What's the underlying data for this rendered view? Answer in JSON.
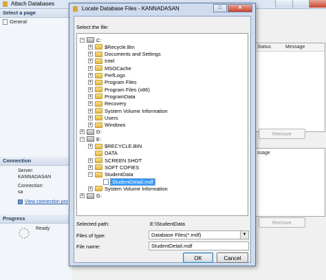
{
  "background_window": {
    "title": "Attach Databases",
    "sidebar": {
      "select_page_heading": "Select a page",
      "pages": [
        "General"
      ],
      "connection_heading": "Connection",
      "server_label": "Server:",
      "server_value": "KANNADASAN",
      "connection_label": "Connection:",
      "connection_value": "sa",
      "view_connection_link": "View connection pro",
      "progress_heading": "Progress",
      "progress_status": "Ready"
    },
    "grid_headers": {
      "status": "Status",
      "message": "Message"
    },
    "lower_grid_header": "ssage",
    "remove_button_top": "Remove",
    "remove_button_bottom": "Remove"
  },
  "dialog": {
    "title": "Locate Database Files - KANNADASAN",
    "select_file_label": "Select the file:",
    "tree": [
      {
        "label": "C:",
        "kind": "drive",
        "expander": "−"
      },
      {
        "label": "$Recycle.Bin",
        "kind": "folder",
        "expander": "+"
      },
      {
        "label": "Documents and Settings",
        "kind": "folder",
        "expander": "+"
      },
      {
        "label": "Intel",
        "kind": "folder",
        "expander": "+"
      },
      {
        "label": "MSOCache",
        "kind": "folder",
        "expander": "+"
      },
      {
        "label": "PerfLogs",
        "kind": "folder",
        "expander": "+"
      },
      {
        "label": "Program Files",
        "kind": "folder",
        "expander": "+"
      },
      {
        "label": "Program Files (x86)",
        "kind": "folder",
        "expander": "+"
      },
      {
        "label": "ProgramData",
        "kind": "folder",
        "expander": "+"
      },
      {
        "label": "Recovery",
        "kind": "folder",
        "expander": "+"
      },
      {
        "label": "System Volume Information",
        "kind": "folder",
        "expander": "+"
      },
      {
        "label": "Users",
        "kind": "folder",
        "expander": "+"
      },
      {
        "label": "Windows",
        "kind": "folder",
        "expander": "+"
      },
      {
        "label": "D:",
        "kind": "drive",
        "expander": "+"
      },
      {
        "label": "E:",
        "kind": "drive",
        "expander": "−"
      },
      {
        "label": "$RECYCLE.BIN",
        "kind": "folder",
        "expander": "+"
      },
      {
        "label": "DATA",
        "kind": "folder",
        "expander": ""
      },
      {
        "label": "SCREEN SHOT",
        "kind": "folder",
        "expander": "+"
      },
      {
        "label": "SOFT COPIES",
        "kind": "folder",
        "expander": "+"
      },
      {
        "label": "StudentData",
        "kind": "folder",
        "expander": "−"
      },
      {
        "label": "StudentDetail.mdf",
        "kind": "file",
        "expander": "",
        "selected": true
      },
      {
        "label": "System Volume Information",
        "kind": "folder",
        "expander": "+"
      },
      {
        "label": "G:",
        "kind": "drive",
        "expander": "+"
      }
    ],
    "selected_path_label": "Selected path:",
    "selected_path_value": "E:\\StudentData",
    "files_of_type_label": "Files of type:",
    "files_of_type_value": "Database Files(*.mdf)",
    "file_name_label": "File name:",
    "file_name_value": "StudentDetail.mdf",
    "ok_label": "OK",
    "cancel_label": "Cancel"
  }
}
